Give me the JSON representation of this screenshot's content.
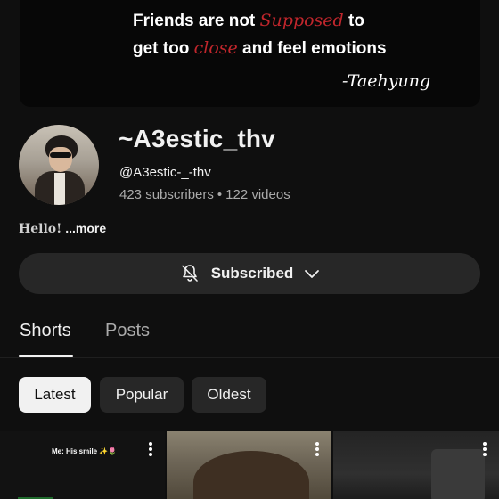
{
  "banner": {
    "line1_a": "Friends are not",
    "line1_script": "Supposed",
    "line1_b": "to",
    "line2_a": "get too",
    "line2_script": "close",
    "line2_b": "and feel emotions",
    "signature": "-Taehyung"
  },
  "channel": {
    "name": "~A3estic_thv",
    "handle": "@A3estic-_-thv",
    "subscribers": "423 subscribers",
    "separator": "•",
    "videos": "122 videos",
    "about": "Hello!",
    "more": "...more"
  },
  "subscribe": {
    "label": "Subscribed",
    "bell_icon": "bell-off-icon",
    "chevron_icon": "chevron-down-icon"
  },
  "tabs": [
    {
      "label": "Shorts",
      "selected": true
    },
    {
      "label": "Posts",
      "selected": false
    }
  ],
  "chips": [
    {
      "label": "Latest",
      "selected": true
    },
    {
      "label": "Popular",
      "selected": false
    },
    {
      "label": "Oldest",
      "selected": false
    }
  ],
  "shorts": [
    {
      "caption": "Me: His smile ✨🌷"
    },
    {
      "caption": ""
    },
    {
      "caption": ""
    }
  ],
  "colors": {
    "background": "#0f0f0f",
    "chip_selected": "#f1f1f1",
    "chip": "#272727",
    "banner_script": "#c0262c"
  }
}
